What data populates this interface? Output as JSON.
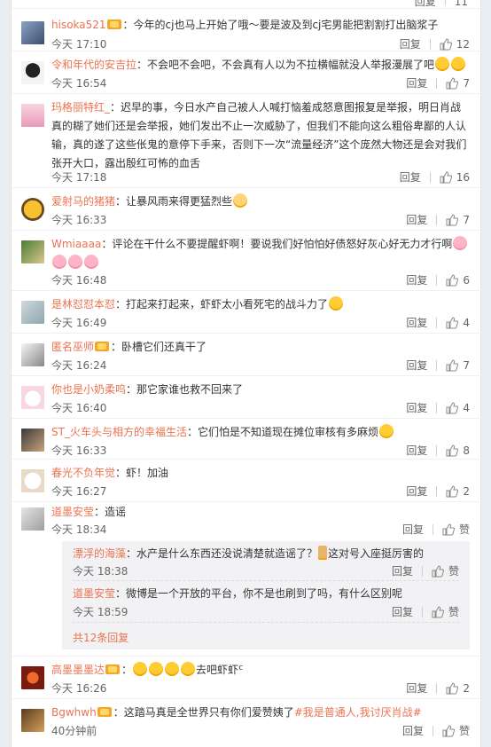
{
  "labels": {
    "reply": "回复",
    "like": "赞"
  },
  "top_partial": {
    "likes": "11"
  },
  "comments": [
    {
      "user": "hisoka521",
      "vip": true,
      "text": "：今年的cj也马上开始了哦～要是波及到cj宅男能把割割打出脑浆子",
      "time": "今天 17:10",
      "likes": "12"
    },
    {
      "user": "令和年代的安吉拉",
      "vip": false,
      "text": "：不会吧不会吧，不会真有人以为不拉横幅就没人举报漫展了吧",
      "time": "今天 16:54",
      "likes": "7"
    },
    {
      "user": "玛格丽特红_",
      "vip": false,
      "text": "：迟早的事，今日水产自己被人人喊打恼羞成怒意图报复是举报，明日肖战真的糊了她们还是会举报，她们发出不止一次威胁了，但我们不能向这么粗俗卑鄙的人认输，真的遂了这些伥鬼的意停下手来，否则下一次“流量经济”这个庞然大物还是会对我们张开大口，露出殷红可怖的血舌",
      "time": "今天 17:18",
      "likes": "16"
    },
    {
      "user": "爱射马的猪猪",
      "vip": false,
      "text": "：让暴风雨来得更猛烈些",
      "time": "今天 16:33",
      "likes": "7"
    },
    {
      "user": "Wmiaaaa",
      "vip": false,
      "text": "：评论在干什么不要提醒虾啊！要说我们好怕怕好债怒好灰心好无力才行啊",
      "time": "今天 16:48",
      "likes": "6"
    },
    {
      "user": "是林怼怼本怼",
      "vip": false,
      "text": "：打起来打起来，虾虾太小看死宅的战斗力了",
      "time": "今天 16:49",
      "likes": "4"
    },
    {
      "user": "匿名巫师",
      "vip": true,
      "text": "：卧槽它们还真干了",
      "time": "今天 16:24",
      "likes": "7"
    },
    {
      "user": "你也是小奶柔呜",
      "vip": false,
      "text": "：那它家谁也救不回来了",
      "time": "今天 16:40",
      "likes": "4"
    },
    {
      "user": "ST_火车头与相方的幸福生活",
      "vip": false,
      "text": "：它们怕是不知道现在摊位审核有多麻烦",
      "time": "今天 16:33",
      "likes": "8"
    },
    {
      "user": "春光不负年觉",
      "vip": false,
      "text": "：虾！加油",
      "time": "今天 16:27",
      "likes": "2"
    },
    {
      "user": "道墨安莹",
      "vip": false,
      "text": "：造谣",
      "time": "今天 18:34",
      "likes": "赞"
    }
  ],
  "replies": [
    {
      "user": "漂浮的海藻",
      "text": "：水产是什么东西还没说清楚就造谣了？",
      "text2": "这对号入座挺厉害的",
      "time": "今天 18:38",
      "likes": "赞"
    },
    {
      "user": "道墨安莹",
      "text": "：微博是一个开放的平台，你不是也刷到了吗，有什么区别呢",
      "time": "今天 18:59",
      "likes": "赞"
    }
  ],
  "more_replies": "共12条回复",
  "comments2": [
    {
      "user": "高墨墨墨达",
      "vip": true,
      "text": "：",
      "text2": "去吧虾虾ᑦ",
      "time": "今天 16:26",
      "likes": "2"
    },
    {
      "user": "Bgwhwh",
      "vip": true,
      "text": "：这踏马真是全世界只有你们爱赞姨了",
      "hashtag": "#我是普通人,我讨厌肖战#",
      "time": "40分钟前",
      "likes": "赞"
    }
  ]
}
